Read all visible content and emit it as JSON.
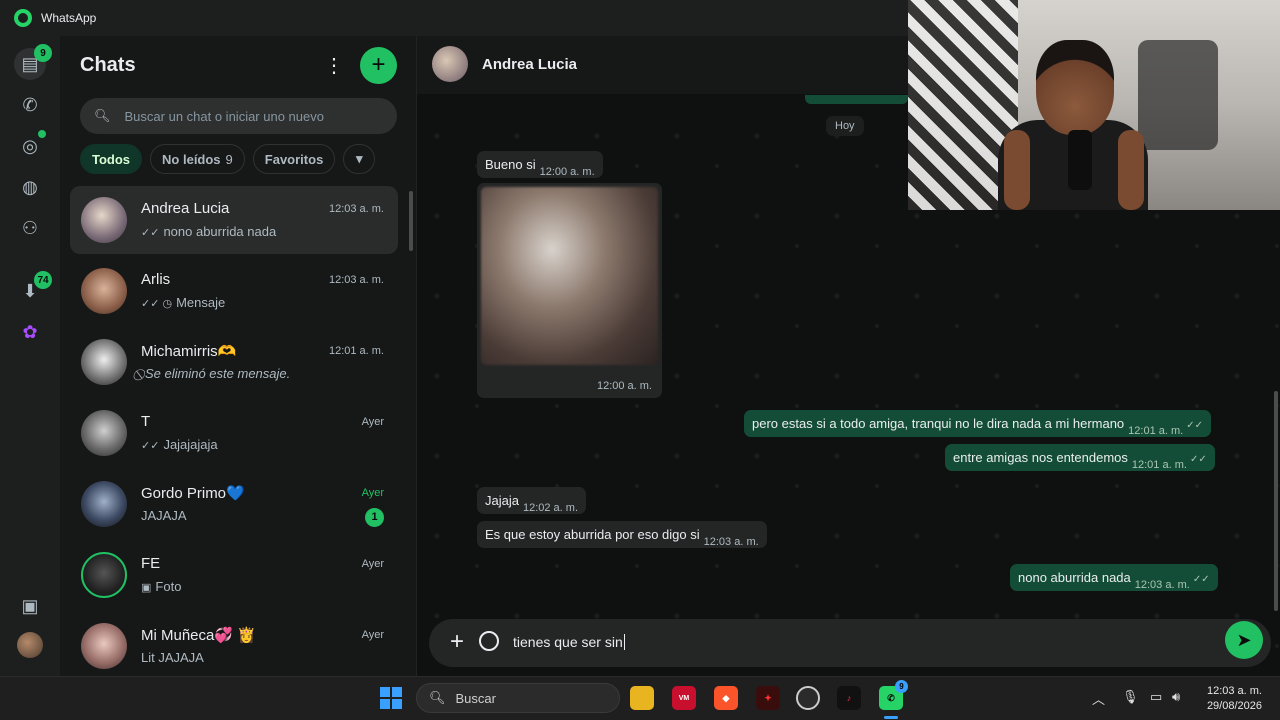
{
  "window": {
    "title": "WhatsApp"
  },
  "rail": {
    "chats_badge": "9",
    "downloads_badge": "74"
  },
  "chatlist": {
    "title": "Chats",
    "search_placeholder": "Buscar un chat o iniciar uno nuevo",
    "filters": [
      {
        "label": "Todos",
        "count": ""
      },
      {
        "label": "No leídos",
        "count": "9"
      },
      {
        "label": "Favoritos",
        "count": ""
      }
    ],
    "items": [
      {
        "name": "Andrea Lucia",
        "time": "12:03 a. m.",
        "preview": "nono aburrida nada",
        "ticks": "✓✓"
      },
      {
        "name": "Arlis",
        "time": "12:03 a. m.",
        "preview": "Mensaje",
        "ticks": "✓✓ ◷"
      },
      {
        "name": "Michamirris🫶",
        "time": "12:01 a. m.",
        "preview": "Se eliminó este mensaje.",
        "ticks": "⃠"
      },
      {
        "name": "T",
        "time": "Ayer",
        "preview": "Jajajajaja",
        "ticks": "✓✓"
      },
      {
        "name": "Gordo Primo💙",
        "time": "Ayer",
        "preview": "JAJAJA",
        "ticks": "",
        "unread": "1"
      },
      {
        "name": "FE",
        "time": "Ayer",
        "preview": "Foto",
        "ticks": "▣"
      },
      {
        "name": "Mi Muñeca💞 👸",
        "time": "Ayer",
        "preview": "Lit JAJAJA",
        "ticks": ""
      }
    ]
  },
  "conversation": {
    "contact": "Andrea Lucia",
    "day_chip": "Hoy",
    "messages": [
      {
        "dir": "in",
        "text": "Bueno si",
        "time": "12:00 a. m."
      },
      {
        "dir": "in",
        "type": "image",
        "time": "12:00 a. m."
      },
      {
        "dir": "out",
        "text": "pero estas si a todo amiga, tranqui no le dira nada a mi hermano",
        "time": "12:01 a. m."
      },
      {
        "dir": "out",
        "text": "entre amigas nos entendemos",
        "time": "12:01 a. m."
      },
      {
        "dir": "in",
        "text": "Jajaja",
        "time": "12:02 a. m."
      },
      {
        "dir": "in",
        "text": "Es que estoy aburrida por eso digo si",
        "time": "12:03 a. m."
      },
      {
        "dir": "out",
        "text": "nono aburrida nada",
        "time": "12:03 a. m."
      }
    ],
    "composer_text": "tienes que ser sin"
  },
  "taskbar": {
    "search_label": "Buscar",
    "clock_time": "12:03 a. m.",
    "clock_date": "29/08/2026",
    "whatsapp_badge": "9"
  },
  "colors": {
    "accent": "#21c063",
    "outgoing_bubble": "#144d37",
    "incoming_bubble": "#242626"
  }
}
